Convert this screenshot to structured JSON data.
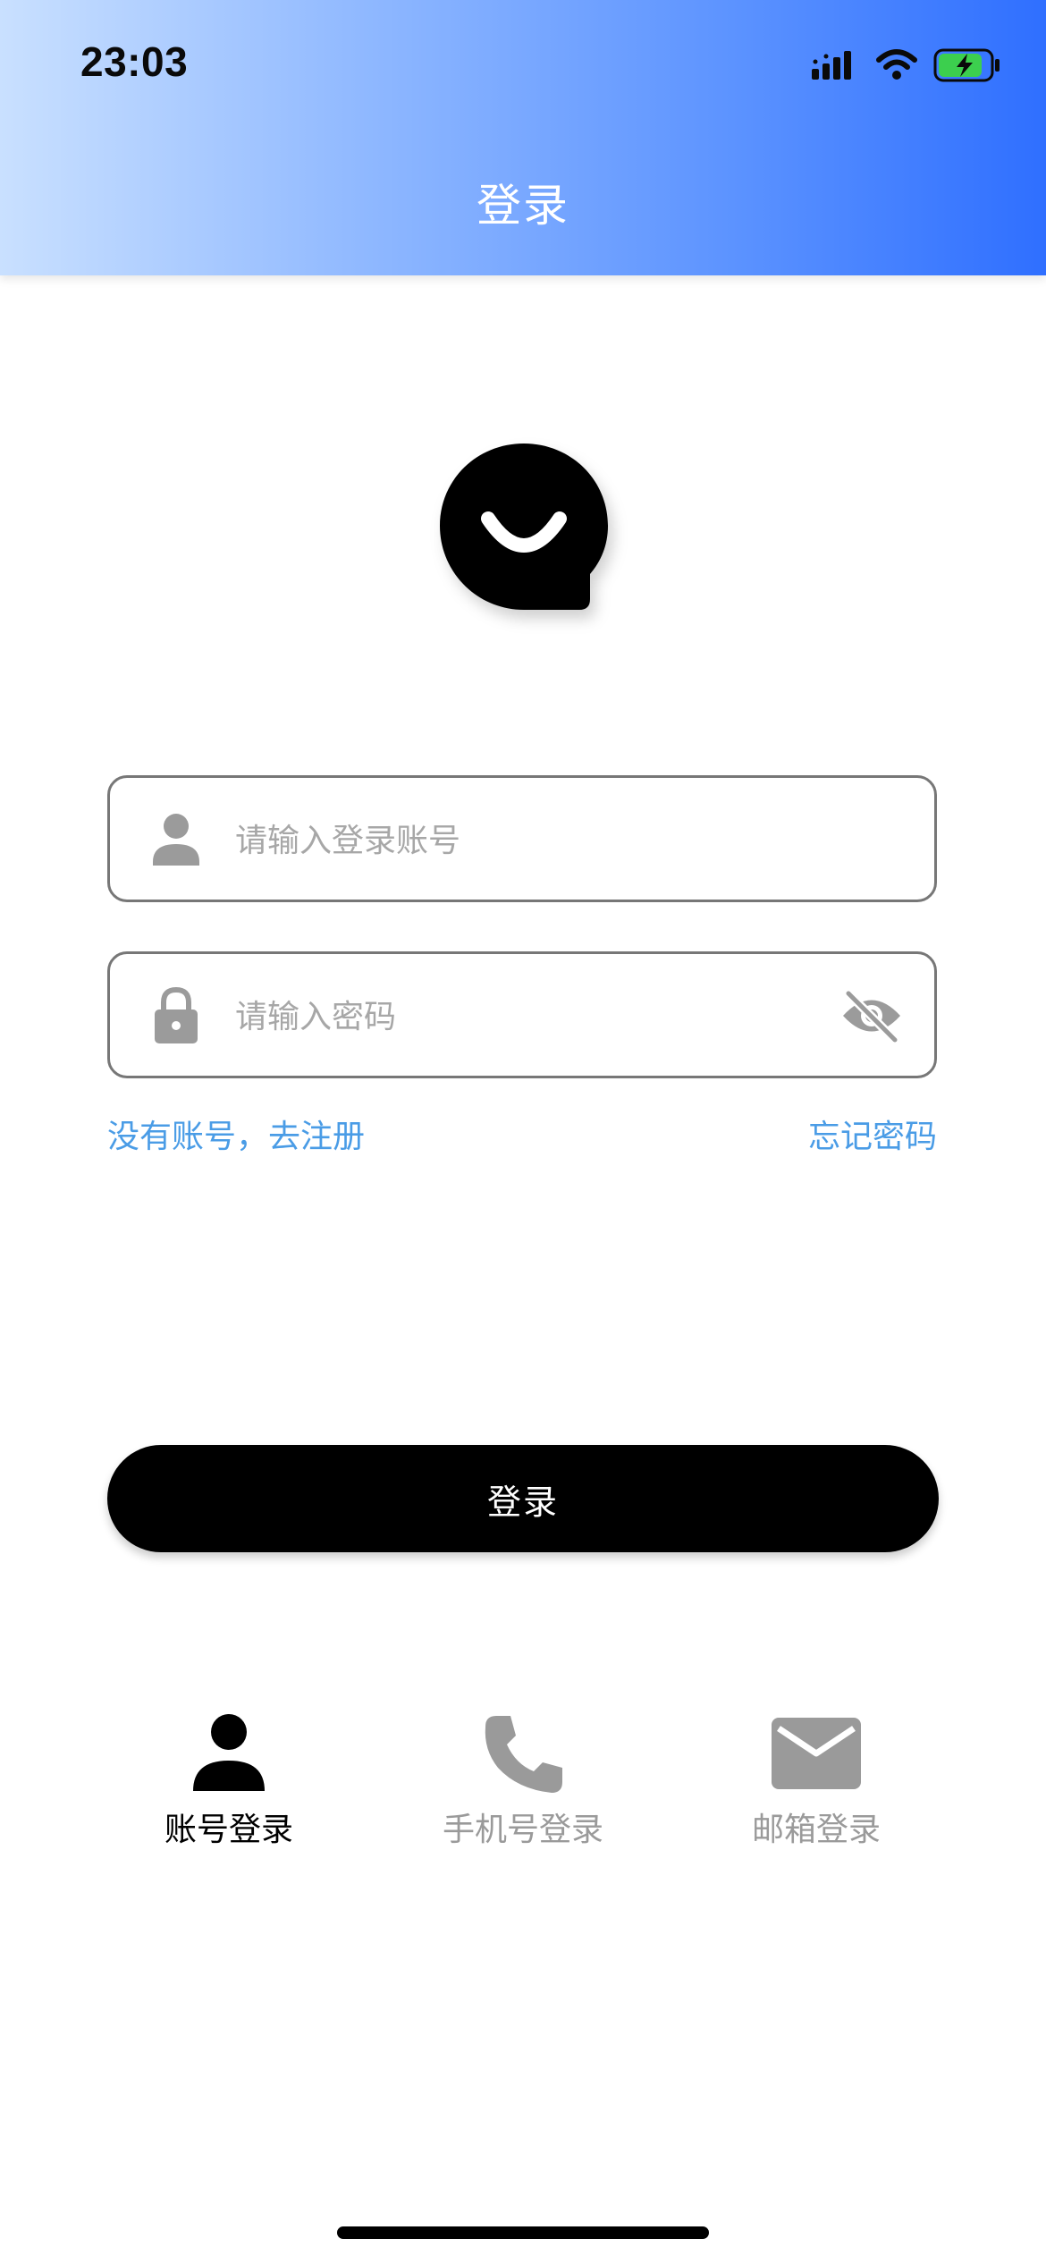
{
  "status_bar": {
    "time": "23:03"
  },
  "header": {
    "title": "登录"
  },
  "logo": {
    "icon": "smile-chat-bubble-logo"
  },
  "form": {
    "account": {
      "placeholder": "请输入登录账号",
      "value": "",
      "icon": "person-icon"
    },
    "password": {
      "placeholder": "请输入密码",
      "value": "",
      "icon": "lock-icon",
      "toggle_icon": "eye-off-icon"
    },
    "register_link": "没有账号，去注册",
    "forgot_link": "忘记密码"
  },
  "login_button": {
    "label": "登录"
  },
  "login_methods": [
    {
      "label": "账号登录",
      "icon": "person-icon",
      "active": true
    },
    {
      "label": "手机号登录",
      "icon": "phone-icon",
      "active": false
    },
    {
      "label": "邮箱登录",
      "icon": "mail-icon",
      "active": false
    }
  ],
  "colors": {
    "header_gradient_start": "#c9e0ff",
    "header_gradient_end": "#2f6fff",
    "link": "#4a9ce6",
    "button": "#000000",
    "inactive": "#9a9a9a",
    "placeholder": "#a7a7a7"
  }
}
